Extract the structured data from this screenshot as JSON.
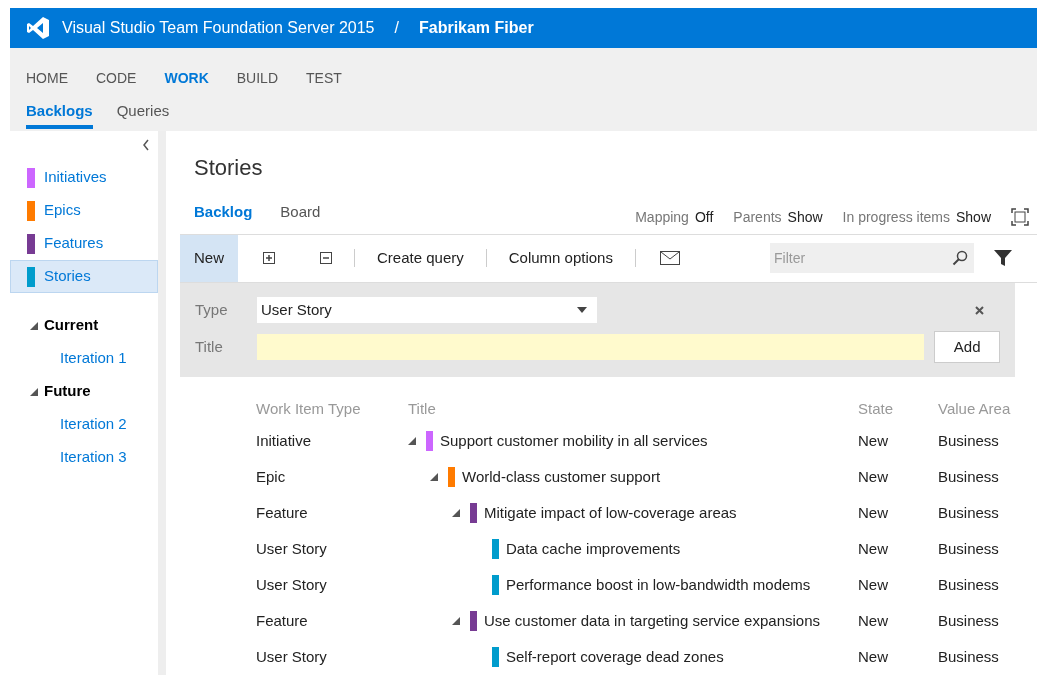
{
  "header": {
    "product": "Visual Studio Team Foundation Server 2015",
    "separator": "/",
    "project": "Fabrikam Fiber"
  },
  "nav": [
    {
      "label": "HOME",
      "selected": false
    },
    {
      "label": "CODE",
      "selected": false
    },
    {
      "label": "WORK",
      "selected": true
    },
    {
      "label": "BUILD",
      "selected": false
    },
    {
      "label": "TEST",
      "selected": false
    }
  ],
  "subnav": [
    {
      "label": "Backlogs",
      "selected": true
    },
    {
      "label": "Queries",
      "selected": false
    }
  ],
  "sidebar": {
    "backlogs": [
      {
        "label": "Initiatives",
        "color": "#cc66ff",
        "selected": false
      },
      {
        "label": "Epics",
        "color": "#ff7b00",
        "selected": false
      },
      {
        "label": "Features",
        "color": "#773b93",
        "selected": false
      },
      {
        "label": "Stories",
        "color": "#009ccc",
        "selected": true
      }
    ],
    "iterations": [
      {
        "label": "Current",
        "expanded": true,
        "children": [
          {
            "label": "Iteration 1"
          }
        ]
      },
      {
        "label": "Future",
        "expanded": true,
        "children": [
          {
            "label": "Iteration 2"
          },
          {
            "label": "Iteration 3"
          }
        ]
      }
    ]
  },
  "page_title": "Stories",
  "views": [
    {
      "label": "Backlog",
      "selected": true
    },
    {
      "label": "Board",
      "selected": false
    }
  ],
  "options": [
    {
      "label": "Mapping",
      "value": "Off"
    },
    {
      "label": "Parents",
      "value": "Show"
    },
    {
      "label": "In progress items",
      "value": "Show"
    }
  ],
  "toolbar": {
    "new": "New",
    "create_query": "Create query",
    "column_options": "Column options",
    "filter_placeholder": "Filter"
  },
  "quick_add": {
    "type_label": "Type",
    "type_value": "User Story",
    "title_label": "Title",
    "add": "Add"
  },
  "table": {
    "columns": [
      "Work Item Type",
      "Title",
      "State",
      "Value Area"
    ],
    "rows": [
      {
        "type": "Initiative",
        "title": "Support customer mobility in all services",
        "state": "New",
        "value_area": "Business",
        "color": "#cc66ff",
        "expanded": true,
        "children": [
          {
            "type": "Epic",
            "title": "World-class customer support",
            "state": "New",
            "value_area": "Business",
            "color": "#ff7b00",
            "expanded": true,
            "children": [
              {
                "type": "Feature",
                "title": "Mitigate impact of low-coverage areas",
                "state": "New",
                "value_area": "Business",
                "color": "#773b93",
                "expanded": true,
                "children": [
                  {
                    "type": "User Story",
                    "title": "Data cache improvements",
                    "state": "New",
                    "value_area": "Business",
                    "color": "#009ccc"
                  },
                  {
                    "type": "User Story",
                    "title": "Performance boost in low-bandwidth modems",
                    "state": "New",
                    "value_area": "Business",
                    "color": "#009ccc"
                  }
                ]
              },
              {
                "type": "Feature",
                "title": "Use customer data in targeting service expansions",
                "state": "New",
                "value_area": "Business",
                "color": "#773b93",
                "expanded": true,
                "children": [
                  {
                    "type": "User Story",
                    "title": "Self-report coverage dead zones",
                    "state": "New",
                    "value_area": "Business",
                    "color": "#009ccc"
                  }
                ]
              }
            ]
          }
        ]
      }
    ]
  }
}
